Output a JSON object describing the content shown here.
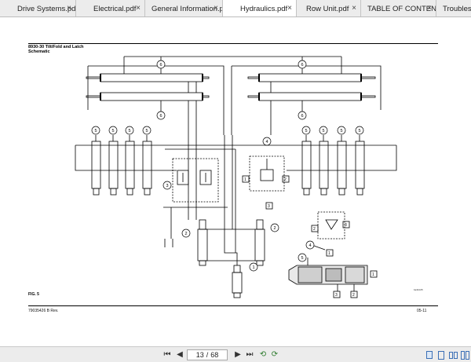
{
  "tabs": [
    {
      "label": "Drive Systems.pdf",
      "active": false
    },
    {
      "label": "Electrical.pdf",
      "active": false
    },
    {
      "label": "General Information.pdf",
      "active": false
    },
    {
      "label": "Hydraulics.pdf",
      "active": true
    },
    {
      "label": "Row Unit.pdf",
      "active": false
    },
    {
      "label": "TABLE OF CONTENT...",
      "active": false
    },
    {
      "label": "Troubleshootin",
      "active": false
    }
  ],
  "document": {
    "title": "8930-30 Tilt/Fold and Latch",
    "subtitle": "Schematic",
    "figure_label": "FIG. 5",
    "figure_id": "ba31025",
    "footer_left": "79035426 B Rev.",
    "footer_right": "05-11"
  },
  "callouts": {
    "c1": "1",
    "c2": "2",
    "c3": "3",
    "c4": "4",
    "c5": "5",
    "c6": "6"
  },
  "toolbar": {
    "current_page": "13",
    "page_separator": "/",
    "total_pages": "68"
  },
  "icons": {
    "first_page": "first-page-icon",
    "prev_page": "previous-page-icon",
    "next_page": "next-page-icon",
    "last_page": "last-page-icon",
    "back": "back-icon",
    "forward": "forward-icon",
    "single_page": "single-page-view-icon",
    "continuous": "continuous-view-icon",
    "facing": "facing-view-icon",
    "facing_continuous": "facing-continuous-view-icon"
  }
}
